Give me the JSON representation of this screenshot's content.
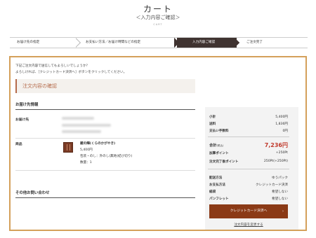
{
  "header": {
    "title": "カート",
    "subtitle": "＜入力内容ご確認＞",
    "en": "CART"
  },
  "steps": [
    {
      "label": "お届け先の指定",
      "active": false
    },
    {
      "label": "お支払い方法／お届け時間などの指定",
      "active": false
    },
    {
      "label": "入力内容ご確認",
      "active": true
    },
    {
      "label": "ご注文完了",
      "active": false
    }
  ],
  "intro": {
    "line1": "下記ご注文内容で送信してもよろしいでしょうか？",
    "line2": "よろしければ、［クレジットカード決済へ］ボタンをクリックしてください。"
  },
  "section_title": "注文内容の確認",
  "delivery": {
    "heading": "お届け先情報",
    "label": "お届け先"
  },
  "product": {
    "label": "商品",
    "name": "蔵の輝(くらのかがやき)",
    "price": "5,400円",
    "options": "包装・のし：外のし(無地(結び切り)",
    "qty": "数量：1"
  },
  "inquiry_heading": "その他お問い合わせ",
  "summary": {
    "subtotal_label": "小計",
    "subtotal": "5,400円",
    "shipping_label": "送料",
    "shipping": "1,836円",
    "fee_label": "支払い手数料",
    "fee": "0円",
    "total_label": "合計",
    "total_tax": "(税込)",
    "total": "7,236円",
    "points_label": "加算ポイント",
    "points": "+250Pt",
    "after_points_label": "注文完了後ポイント",
    "after_points": "250Pt(+250Pt)",
    "method_label": "配送方法",
    "method": "ゆうパック",
    "payment_label": "お支払方法",
    "payment": "クレジットカード決済",
    "wrap_label": "紙袋",
    "wrap": "希望しない",
    "pamphlet_label": "パンフレット",
    "pamphlet": "希望しない"
  },
  "cta": {
    "label": "クレジットカード決済へ",
    "arrow": "›"
  },
  "change_link": "注文内容を変更する",
  "colors": {
    "accent": "#b56b4b",
    "cta": "#8b3a16",
    "frame": "#d4a05a",
    "total": "#c0392b",
    "active_step": "#3f3330"
  }
}
